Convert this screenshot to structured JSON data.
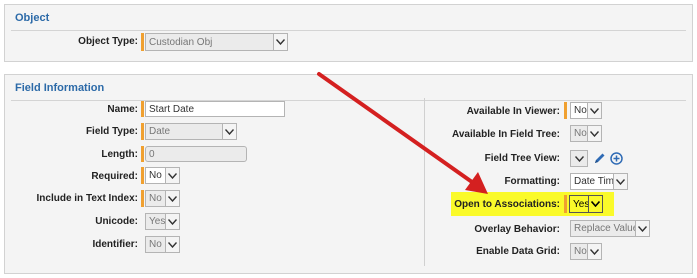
{
  "object_section": {
    "title": "Object",
    "object_type_label": "Object Type:",
    "object_type_value": "Custodian Obj"
  },
  "field_section": {
    "title": "Field Information",
    "left": {
      "name_label": "Name:",
      "name_value": "Start Date",
      "field_type_label": "Field Type:",
      "field_type_value": "Date",
      "length_label": "Length:",
      "length_value": "0",
      "required_label": "Required:",
      "required_value": "No",
      "text_index_label": "Include in Text Index:",
      "text_index_value": "No",
      "unicode_label": "Unicode:",
      "unicode_value": "Yes",
      "identifier_label": "Identifier:",
      "identifier_value": "No"
    },
    "right": {
      "viewer_label": "Available In Viewer:",
      "viewer_value": "No",
      "field_tree_label": "Available In Field Tree:",
      "field_tree_value": "No",
      "field_tree_view_label": "Field Tree View:",
      "formatting_label": "Formatting:",
      "formatting_value": "Date Time",
      "associations_label": "Open to Associations:",
      "associations_value": "Yes",
      "overlay_label": "Overlay Behavior:",
      "overlay_value": "Replace Values",
      "data_grid_label": "Enable Data Grid:",
      "data_grid_value": "No"
    }
  },
  "colors": {
    "section_title": "#2c6aa8",
    "required_marker": "#f0a030",
    "highlight": "#fafa2a",
    "annotation_arrow": "#d42020"
  },
  "icons": [
    "chevron-down-icon",
    "pencil-icon",
    "plus-circle-icon"
  ]
}
